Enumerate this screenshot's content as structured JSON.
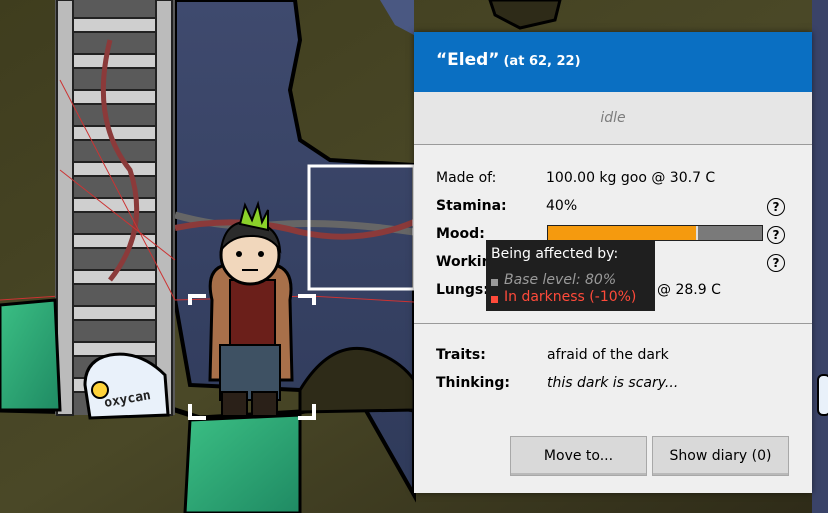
{
  "panel": {
    "name": "“Eled”",
    "coords": "(at 62, 22)",
    "status": "idle",
    "made_of_label": "Made of:",
    "made_of_value": "100.00 kg goo @ 30.7 C",
    "stamina_label": "Stamina:",
    "stamina_value": "40%",
    "mood_label": "Mood:",
    "mood_level": 0.69,
    "mood_base_level": 0.8,
    "working_label": "Working",
    "lungs_label": "Lungs:",
    "lungs_value": "@ 28.9 C",
    "traits_label": "Traits:",
    "traits_value": "afraid of the dark",
    "thinking_label": "Thinking:",
    "thinking_value": "this dark is scary...",
    "help_glyph": "?",
    "move_button": "Move to...",
    "diary_button": "Show diary (0)"
  },
  "tooltip": {
    "title": "Being affected by:",
    "base": "Base level: 80%",
    "darkness": "In darkness (-10%)"
  },
  "scene": {
    "canister_label": "oxycan"
  },
  "colors": {
    "header": "#0a6fc2",
    "mood_fill": "#f59a0e",
    "warning": "#ff4a3a"
  }
}
